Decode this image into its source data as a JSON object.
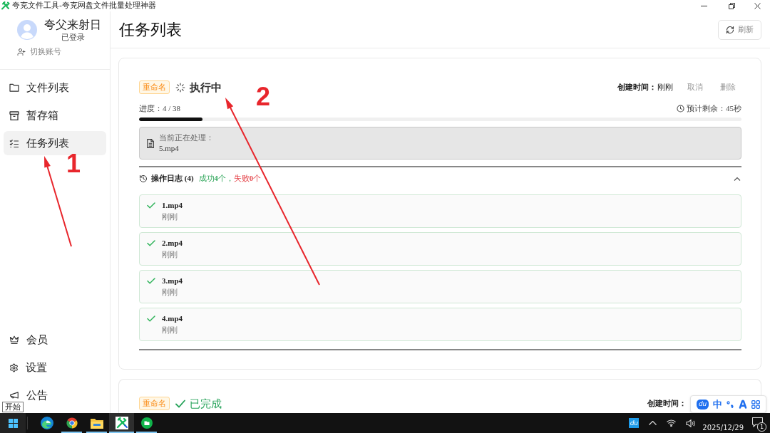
{
  "window": {
    "title": "夸克文件工具-夸克网盘文件批量处理神器"
  },
  "sidebar": {
    "user": {
      "name": "夸父来射日",
      "status": "已登录",
      "switch_label": "切换账号"
    },
    "top_items": [
      {
        "label": "文件列表",
        "selected": false
      },
      {
        "label": "暂存箱",
        "selected": false
      },
      {
        "label": "任务列表",
        "selected": true
      }
    ],
    "bottom_items": [
      {
        "label": "会员",
        "selected": false
      },
      {
        "label": "设置",
        "selected": false
      },
      {
        "label": "公告",
        "selected": false
      }
    ]
  },
  "header": {
    "title": "任务列表",
    "refresh_label": "刷新"
  },
  "tasks": [
    {
      "tag": "重命名",
      "status": "执行中",
      "kind": "running",
      "created_label": "创建时间：",
      "created_value": "刚刚",
      "actions": [
        "取消",
        "删除"
      ],
      "progress_label": "进度：4 / 38",
      "level": 0.105,
      "eta": "预计剩余：45秒",
      "current": {
        "label": "当前正在处理：",
        "file": "5.mp4"
      },
      "log": {
        "title": "操作日志 (4)",
        "success": "成功**4**个，",
        "failure": "失败**0**个",
        "expanded": true,
        "items": [
          {
            "name": "1.mp4",
            "time": "刚刚",
            "kind": "success"
          },
          {
            "name": "2.mp4",
            "time": "刚刚",
            "kind": "success"
          },
          {
            "name": "3.mp4",
            "time": "刚刚",
            "kind": "success"
          },
          {
            "name": "4.mp4",
            "time": "刚刚",
            "kind": "success"
          }
        ]
      }
    },
    {
      "tag": "重命名",
      "status": "已完成",
      "kind": "done",
      "created_label": "创建时间："
    }
  ],
  "annotations": [
    {
      "label": "1"
    },
    {
      "label": "2"
    }
  ],
  "tooltip": "开始",
  "ime_toolbar": {
    "logo": "du",
    "mode": "中"
  },
  "taskbar": {
    "apps": [
      {
        "selected": false,
        "running": false
      },
      {
        "selected": false,
        "running": true
      },
      {
        "selected": false,
        "running": true
      },
      {
        "selected": true,
        "running": true
      },
      {
        "selected": false,
        "running": true
      }
    ],
    "tray": {
      "input_badge": "du",
      "date": "2025/12/29",
      "notifications": "1"
    }
  }
}
